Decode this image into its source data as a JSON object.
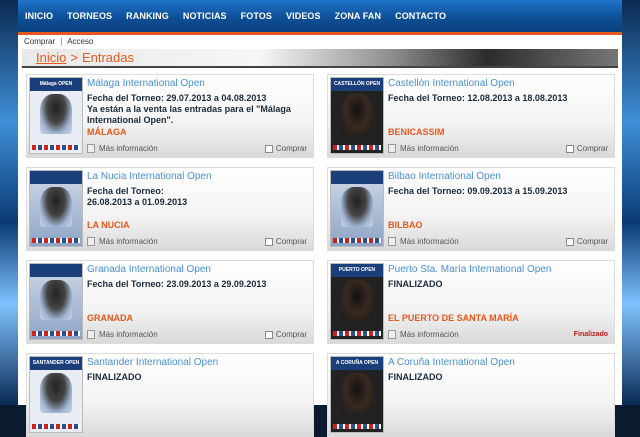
{
  "nav": {
    "items": [
      "INICIO",
      "TORNEOS",
      "RANKING",
      "NOTICIAS",
      "FOTOS",
      "VIDEOS",
      "ZONA FAN",
      "CONTACTO"
    ]
  },
  "subbar": {
    "buy": "Comprar",
    "separator": "|",
    "login": "Acceso"
  },
  "breadcrumb": {
    "home": "Inicio",
    "separator": ">",
    "current": "Entradas"
  },
  "card_labels": {
    "more_info": "Más información",
    "buy": "Comprar"
  },
  "cards": [
    {
      "title": "Málaga International Open",
      "desc": "Fecha del Torneo: 29.07.2013 a 04.08.2013\nYa están a la venta las entradas para el \"Málaga International Open\".",
      "city": "MÁLAGA",
      "poster_label": "Málaga OPEN",
      "status": ""
    },
    {
      "title": "Castellón International Open",
      "desc": "Fecha del Torneo: 12.08.2013 a 18.08.2013",
      "city": "BENICASSIM",
      "poster_label": "CASTELLÓN OPEN",
      "status": ""
    },
    {
      "title": "La Nucia International Open",
      "desc": "Fecha del Torneo:\n26.08.2013 a 01.09.2013",
      "city": "LA NUCIA",
      "poster_label": "",
      "status": ""
    },
    {
      "title": "Bilbao International Open",
      "desc": "Fecha del Torneo: 09.09.2013 a 15.09.2013",
      "city": "BILBAO",
      "poster_label": "",
      "status": ""
    },
    {
      "title": "Granada International Open",
      "desc": "Fecha del Torneo: 23.09.2013 a 29.09.2013",
      "city": "GRANADA",
      "poster_label": "",
      "status": ""
    },
    {
      "title": "Puerto Sta. María International Open",
      "desc": "FINALIZADO",
      "city": "EL PUERTO DE SANTA MARÍA",
      "poster_label": "PUERTO OPEN",
      "status": "Finalizado"
    },
    {
      "title": "Santander International Open",
      "desc": "FINALIZADO",
      "city": "",
      "poster_label": "SANTANDER OPEN",
      "status": ""
    },
    {
      "title": "A Coruña International Open",
      "desc": "FINALIZADO",
      "city": "",
      "poster_label": "A CORUÑA OPEN",
      "status": ""
    }
  ],
  "colors": {
    "nav_blue": "#0f4f98",
    "accent_orange": "#e8581d",
    "title_blue": "#4a90d6",
    "finalizado_red": "#c21a1a"
  }
}
